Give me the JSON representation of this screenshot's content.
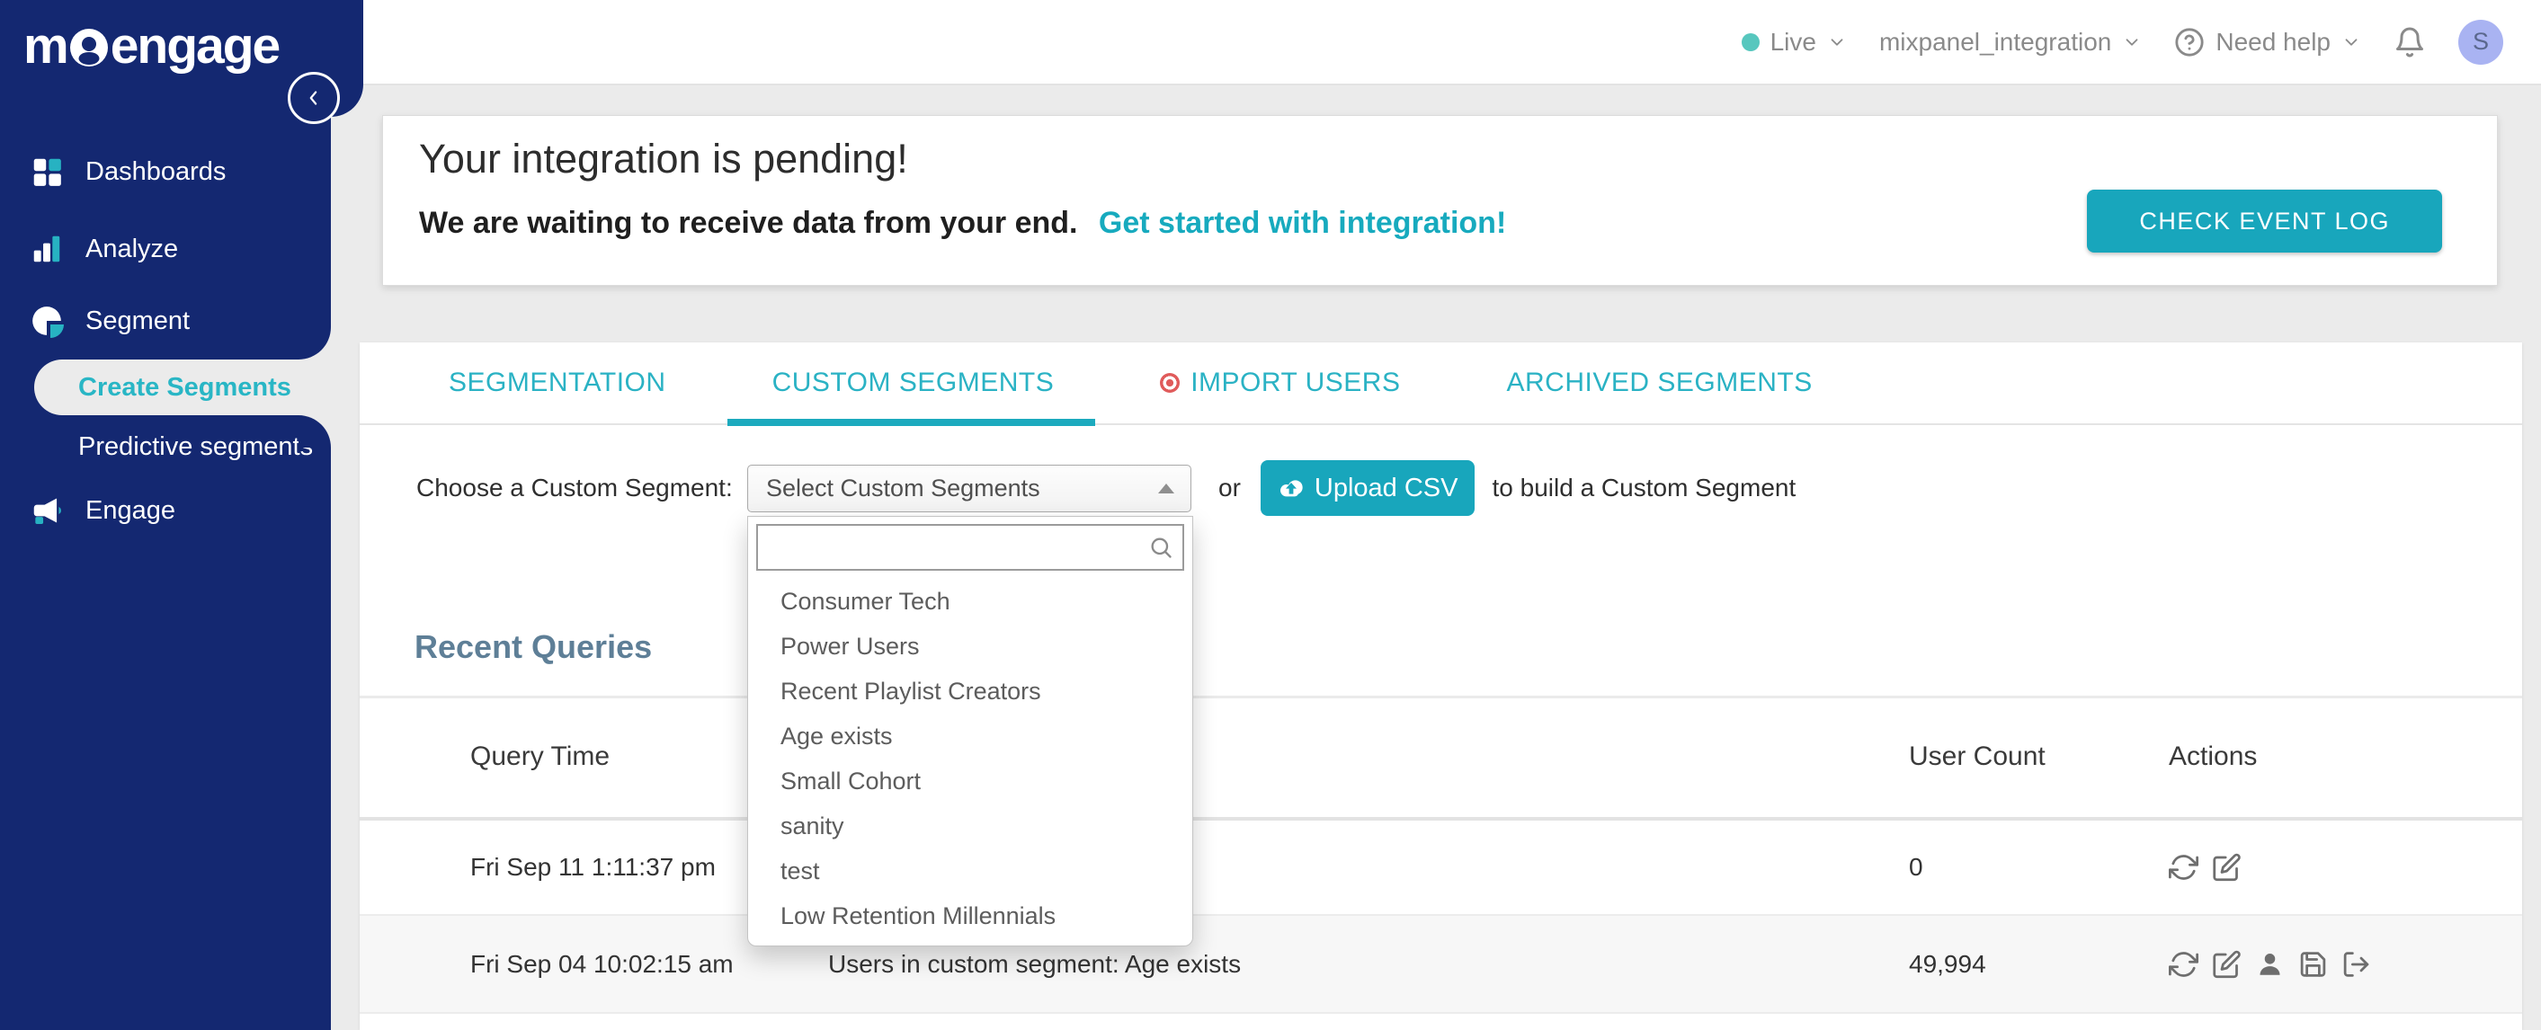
{
  "brand": {
    "logo_prefix": "m",
    "logo_suffix": "engage"
  },
  "header": {
    "environment": "Live",
    "app_name": "mixpanel_integration",
    "help_label": "Need help",
    "avatar_initial": "S"
  },
  "sidebar": {
    "items": [
      {
        "label": "Dashboards",
        "icon": "dashboard-grid-icon"
      },
      {
        "label": "Analyze",
        "icon": "bar-chart-icon"
      },
      {
        "label": "Segment",
        "icon": "pie-chart-icon"
      },
      {
        "label": "Create Segments",
        "active": true
      },
      {
        "label": "Predictive segments"
      },
      {
        "label": "Engage",
        "icon": "megaphone-icon"
      }
    ]
  },
  "banner": {
    "title": "Your integration is pending!",
    "message": "We are waiting to receive data from your end.",
    "link": "Get started with integration!",
    "button": "CHECK EVENT LOG"
  },
  "tabs": [
    {
      "label": "SEGMENTATION",
      "active": false
    },
    {
      "label": "CUSTOM SEGMENTS",
      "active": true
    },
    {
      "label": "IMPORT USERS",
      "active": false,
      "bullet": true
    },
    {
      "label": "ARCHIVED SEGMENTS",
      "active": false
    }
  ],
  "segment_picker": {
    "label": "Choose a Custom Segment:",
    "select_value": "Select Custom Segments",
    "or_text": "or",
    "upload_button": "Upload CSV",
    "suffix_text": "to build a Custom Segment",
    "search_value": "",
    "search_placeholder": "",
    "options": [
      "Consumer Tech",
      "Power Users",
      "Recent Playlist Creators",
      "Age exists",
      "Small Cohort",
      "sanity",
      "test",
      "Low Retention Millennials"
    ]
  },
  "recent_queries": {
    "title": "Recent Queries",
    "columns": [
      "Query Time",
      "",
      "User Count",
      "Actions"
    ],
    "rows": [
      {
        "query_time": "Fri Sep 11 1:11:37 pm",
        "query": "",
        "user_count": "0",
        "actions": [
          "refresh",
          "edit"
        ]
      },
      {
        "query_time": "Fri Sep 04 10:02:15 am",
        "query": "Users in custom segment: Age exists",
        "user_count": "49,994",
        "actions": [
          "refresh",
          "edit",
          "user",
          "save",
          "export"
        ]
      }
    ]
  },
  "colors": {
    "sidebar_navy": "#142871",
    "accent_teal": "#18A6BC",
    "tab_teal": "#2AB2C4",
    "live_dot": "#57C7BE",
    "avatar_bg": "#A9B3F2",
    "recent_queries_title": "#5E7F97",
    "import_users_bullet": "#E05B5B",
    "page_background": "#EBEBEB"
  }
}
